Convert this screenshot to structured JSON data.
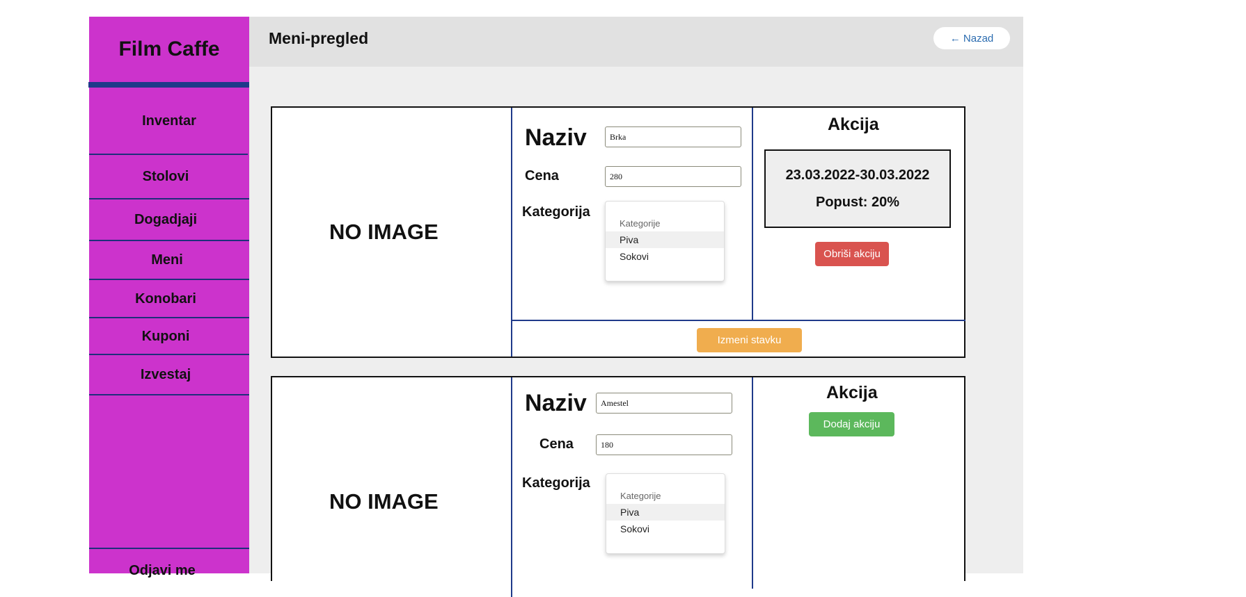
{
  "app": {
    "brand": "Film Caffe"
  },
  "sidebar": {
    "items": [
      {
        "label": "Inventar"
      },
      {
        "label": "Stolovi"
      },
      {
        "label": "Dogadjaji"
      },
      {
        "label": "Meni"
      },
      {
        "label": "Konobari"
      },
      {
        "label": "Kuponi"
      },
      {
        "label": "Izvestaj"
      }
    ],
    "logout_label": "Odjavi me"
  },
  "header": {
    "title": "Meni-pregled",
    "back_label": "← Nazad"
  },
  "items": [
    {
      "image_placeholder": "NO IMAGE",
      "naziv_label": "Naziv",
      "naziv_value": "Brka",
      "cena_label": "Cena",
      "cena_value": "280",
      "kategorija_label": "Kategorija",
      "category_header": "Kategorije",
      "category_options": [
        "Piva",
        "Sokovi"
      ],
      "selected_category": "Piva",
      "akcija_title": "Akcija",
      "promo_dates": "23.03.2022-30.03.2022",
      "promo_discount": "Popust: 20%",
      "delete_promo_label": "Obriši akciju",
      "edit_label": "Izmeni stavku"
    },
    {
      "image_placeholder": "NO IMAGE",
      "naziv_label": "Naziv",
      "naziv_value": "Amestel",
      "cena_label": "Cena",
      "cena_value": "180",
      "kategorija_label": "Kategorija",
      "category_header": "Kategorije",
      "category_options": [
        "Piva",
        "Sokovi"
      ],
      "selected_category": "Piva",
      "akcija_title": "Akcija",
      "add_promo_label": "Dodaj akciju"
    }
  ],
  "colors": {
    "sidebar": "#cc33cc",
    "accent_bar": "#1f3a8a",
    "delete_button": "#d9534f",
    "add_button": "#5cb85c",
    "edit_button": "#f0ad4e"
  }
}
